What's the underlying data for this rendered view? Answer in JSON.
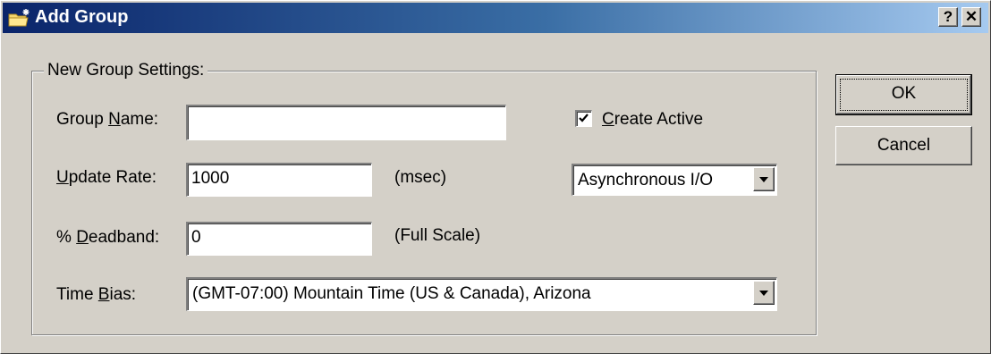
{
  "window": {
    "title": "Add Group",
    "help_button": "?",
    "close_button": "✕"
  },
  "group_box": {
    "legend": "New Group Settings:"
  },
  "fields": {
    "group_name": {
      "label_pre": "Group ",
      "label_key": "N",
      "label_post": "ame:",
      "value": ""
    },
    "update_rate": {
      "label_pre": "",
      "label_key": "U",
      "label_post": "pdate Rate:",
      "value": "1000",
      "unit": "(msec)"
    },
    "deadband": {
      "label_pre": "% ",
      "label_key": "D",
      "label_post": "eadband:",
      "value": "0",
      "unit": "(Full Scale)"
    },
    "time_bias": {
      "label_pre": "Time ",
      "label_key": "B",
      "label_post": "ias:",
      "value": "(GMT-07:00) Mountain Time (US & Canada), Arizona"
    }
  },
  "create_active": {
    "checked": true,
    "label_key": "C",
    "label_post": "reate Active"
  },
  "io_mode": {
    "value": "Asynchronous I/O"
  },
  "buttons": {
    "ok": "OK",
    "cancel": "Cancel"
  }
}
